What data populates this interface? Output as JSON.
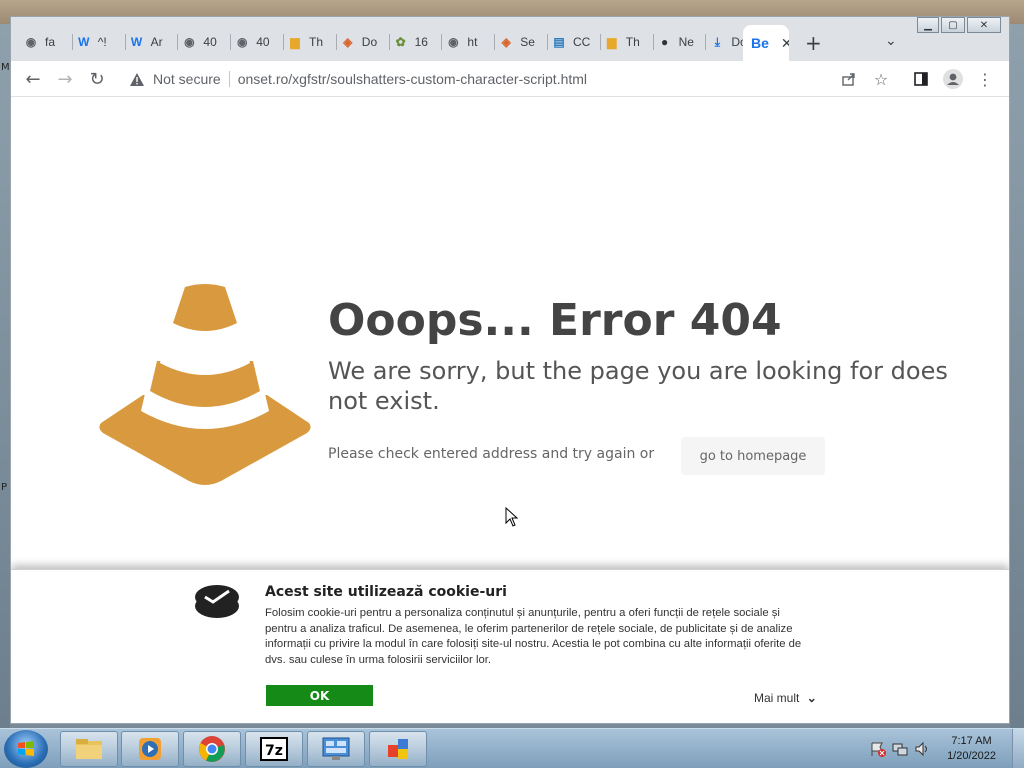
{
  "tabs": [
    {
      "title": "fa",
      "icon": "globe-icon"
    },
    {
      "title": "^!",
      "icon": "wikipedia-icon"
    },
    {
      "title": "Ar",
      "icon": "wikipedia-icon"
    },
    {
      "title": "40",
      "icon": "globe-icon"
    },
    {
      "title": "40",
      "icon": "globe-icon"
    },
    {
      "title": "Th",
      "icon": "folder-icon"
    },
    {
      "title": "Do",
      "icon": "colorful-icon"
    },
    {
      "title": "16",
      "icon": "gear-icon"
    },
    {
      "title": "ht",
      "icon": "globe-icon"
    },
    {
      "title": "Se",
      "icon": "colorful-icon"
    },
    {
      "title": "CC",
      "icon": "book-icon"
    },
    {
      "title": "Th",
      "icon": "folder-icon"
    },
    {
      "title": "Ne",
      "icon": "github-icon"
    },
    {
      "title": "Do",
      "icon": "download-icon"
    }
  ],
  "active_tab": {
    "title": "Be",
    "icon": "behance-icon"
  },
  "address": {
    "security_label": "Not secure",
    "url": "onset.ro/xgfstr/soulshatters-custom-character-script.html"
  },
  "page": {
    "title": "Ooops... Error 404",
    "subtitle": "We are sorry, but the page you are looking for does not exist.",
    "hint": "Please check entered address and try again or",
    "home_button": "go to homepage",
    "cone_color": "#d99a3f"
  },
  "cookie": {
    "title": "Acest site utilizează cookie-uri",
    "text": "Folosim cookie-uri pentru a personaliza conținutul și anunțurile, pentru a oferi funcții de rețele sociale și pentru a analiza traficul. De asemenea, le oferim partenerilor de rețele sociale, de publicitate și de analize informații cu privire la modul în care folosiți site-ul nostru. Acestia le pot combina cu alte informații oferite de dvs. sau culese în urma folosirii serviciilor lor.",
    "ok_label": "OK",
    "more_label": "Mai mult",
    "ok_color": "#168a16"
  },
  "taskbar": {
    "time": "7:17 AM",
    "date": "1/20/2022",
    "apps": [
      "file-explorer",
      "media-player",
      "chrome",
      "7zip",
      "control-panel",
      "paint"
    ]
  }
}
